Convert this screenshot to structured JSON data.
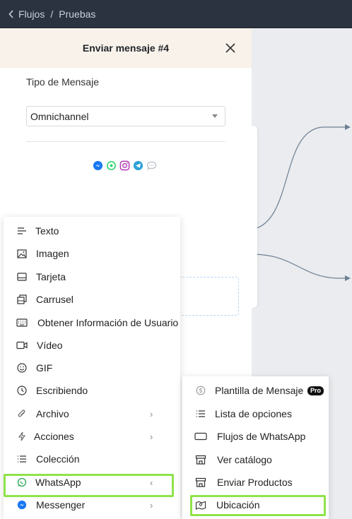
{
  "topbar": {
    "crumb1": "Flujos",
    "separator": "/",
    "crumb2": "Pruebas"
  },
  "panel": {
    "title": "Enviar mensaje #4",
    "type_label": "Tipo de Mensaje",
    "type_value": "Omnichannel",
    "channels": [
      "messenger-icon",
      "whatsapp-icon",
      "instagram-icon",
      "telegram-icon",
      "webchat-icon"
    ]
  },
  "menu": {
    "items": [
      {
        "label": "Texto",
        "icon": "text-lines-icon"
      },
      {
        "label": "Imagen",
        "icon": "image-icon"
      },
      {
        "label": "Tarjeta",
        "icon": "card-icon"
      },
      {
        "label": "Carrusel",
        "icon": "carousel-icon"
      },
      {
        "label": "Obtener Información de Usuario",
        "icon": "keyboard-icon"
      },
      {
        "label": "Vídeo",
        "icon": "video-icon"
      },
      {
        "label": "GIF",
        "icon": "gif-icon"
      },
      {
        "label": "Escribiendo",
        "icon": "clock-icon"
      },
      {
        "label": "Archivo",
        "icon": "paperclip-icon"
      },
      {
        "label": "Acciones",
        "icon": "lightning-icon"
      },
      {
        "label": "Colección",
        "icon": "list-icon"
      },
      {
        "label": "WhatsApp",
        "icon": "whatsapp-icon"
      },
      {
        "label": "Messenger",
        "icon": "messenger-icon"
      }
    ]
  },
  "submenu": {
    "items": [
      {
        "label": "Plantilla de Mensaje",
        "icon": "template-icon",
        "badge": "Pro"
      },
      {
        "label": "Lista de opciones",
        "icon": "list-icon"
      },
      {
        "label": "Flujos de WhatsApp",
        "icon": "flow-icon"
      },
      {
        "label": "Ver catálogo",
        "icon": "store-icon"
      },
      {
        "label": "Enviar Productos",
        "icon": "store-icon"
      },
      {
        "label": "Ubicación",
        "icon": "map-icon"
      }
    ]
  },
  "colors": {
    "highlight": "#8ee34a",
    "topbar": "#2b3240",
    "header_bg": "#f8f2ea"
  }
}
